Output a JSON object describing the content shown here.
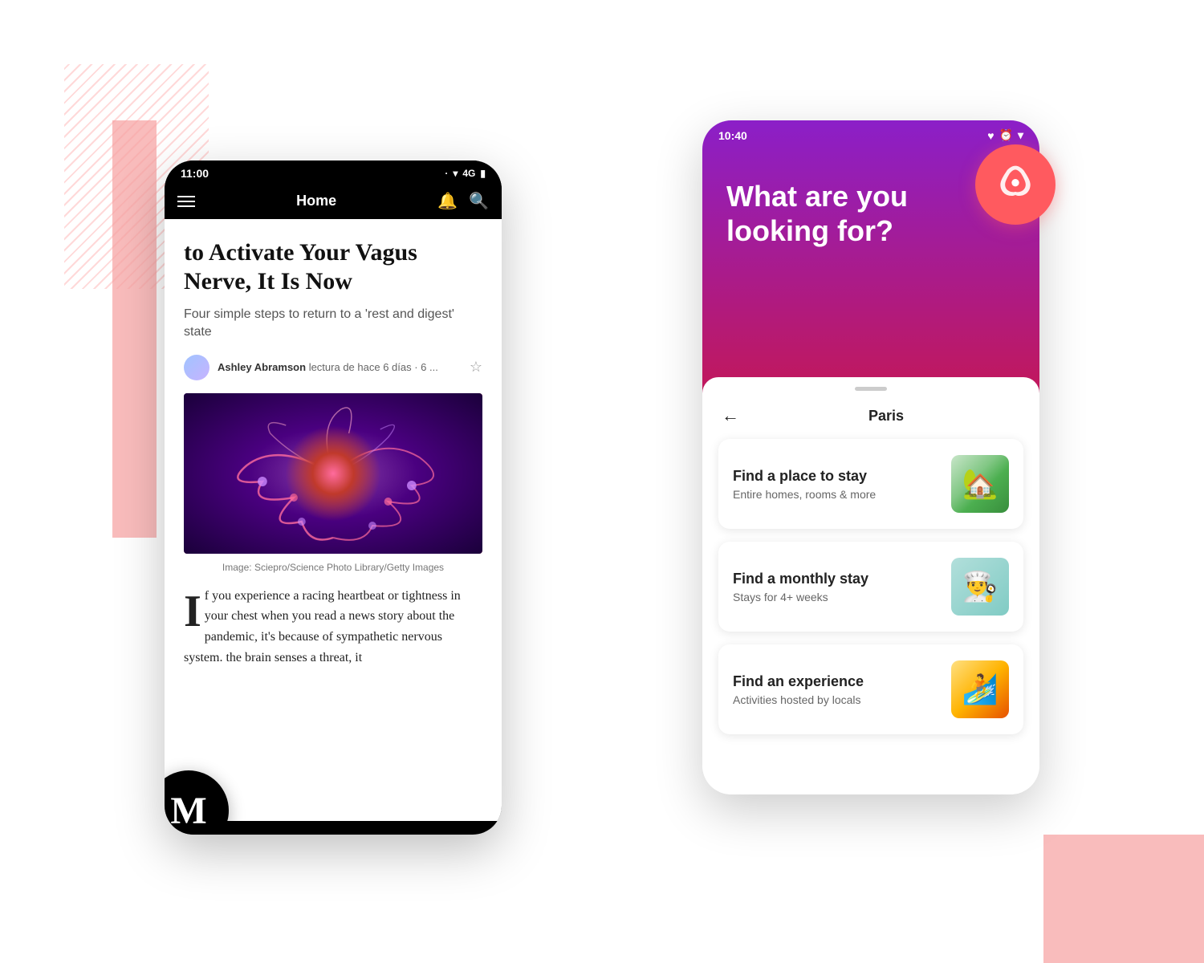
{
  "background": {
    "stripes_color": "#ffb3b3",
    "rect_color": "#f7a0a0"
  },
  "medium_phone": {
    "status_bar": {
      "time": "11:00",
      "icons": [
        "signal",
        "wifi",
        "4g",
        "battery"
      ]
    },
    "nav": {
      "title": "Home",
      "has_hamburger": true,
      "has_bell": true,
      "has_search": true
    },
    "article": {
      "title": "to Activate Your Vagus Nerve, It Is Now",
      "subtitle": "Four simple steps to return to a 'rest and digest' state",
      "author_name": "Ashley Abramson",
      "author_meta": "lectura de hace 6 días · 6 ...",
      "image_caption": "Image: Sciepro/Science Photo Library/Getty Images",
      "body_start": "If you experience a racing heartbeat or tightness in your chest when you read a news story about the pandemic, it's because of sympathetic nervous system. the brain senses a threat, it"
    },
    "logo": "M"
  },
  "airbnb_phone": {
    "status_bar": {
      "time": "10:40",
      "icons": [
        "heart",
        "alarm",
        "wifi"
      ]
    },
    "header": {
      "heading_line1": "What are you",
      "heading_line2": "looking for?"
    },
    "sheet": {
      "back_label": "←",
      "city_label": "Paris"
    },
    "options": [
      {
        "id": "stay",
        "title": "Find a place to stay",
        "subtitle": "Entire homes, rooms & more",
        "image_type": "house"
      },
      {
        "id": "monthly",
        "title": "Find a monthly stay",
        "subtitle": "Stays for 4+ weeks",
        "image_type": "person"
      },
      {
        "id": "experience",
        "title": "Find an experience",
        "subtitle": "Activities hosted by locals",
        "image_type": "surfer"
      }
    ]
  },
  "airbnb_logo": {
    "color": "#ff5a5f",
    "label": "Airbnb"
  },
  "medium_logo": {
    "letter": "M",
    "label": "Medium"
  }
}
